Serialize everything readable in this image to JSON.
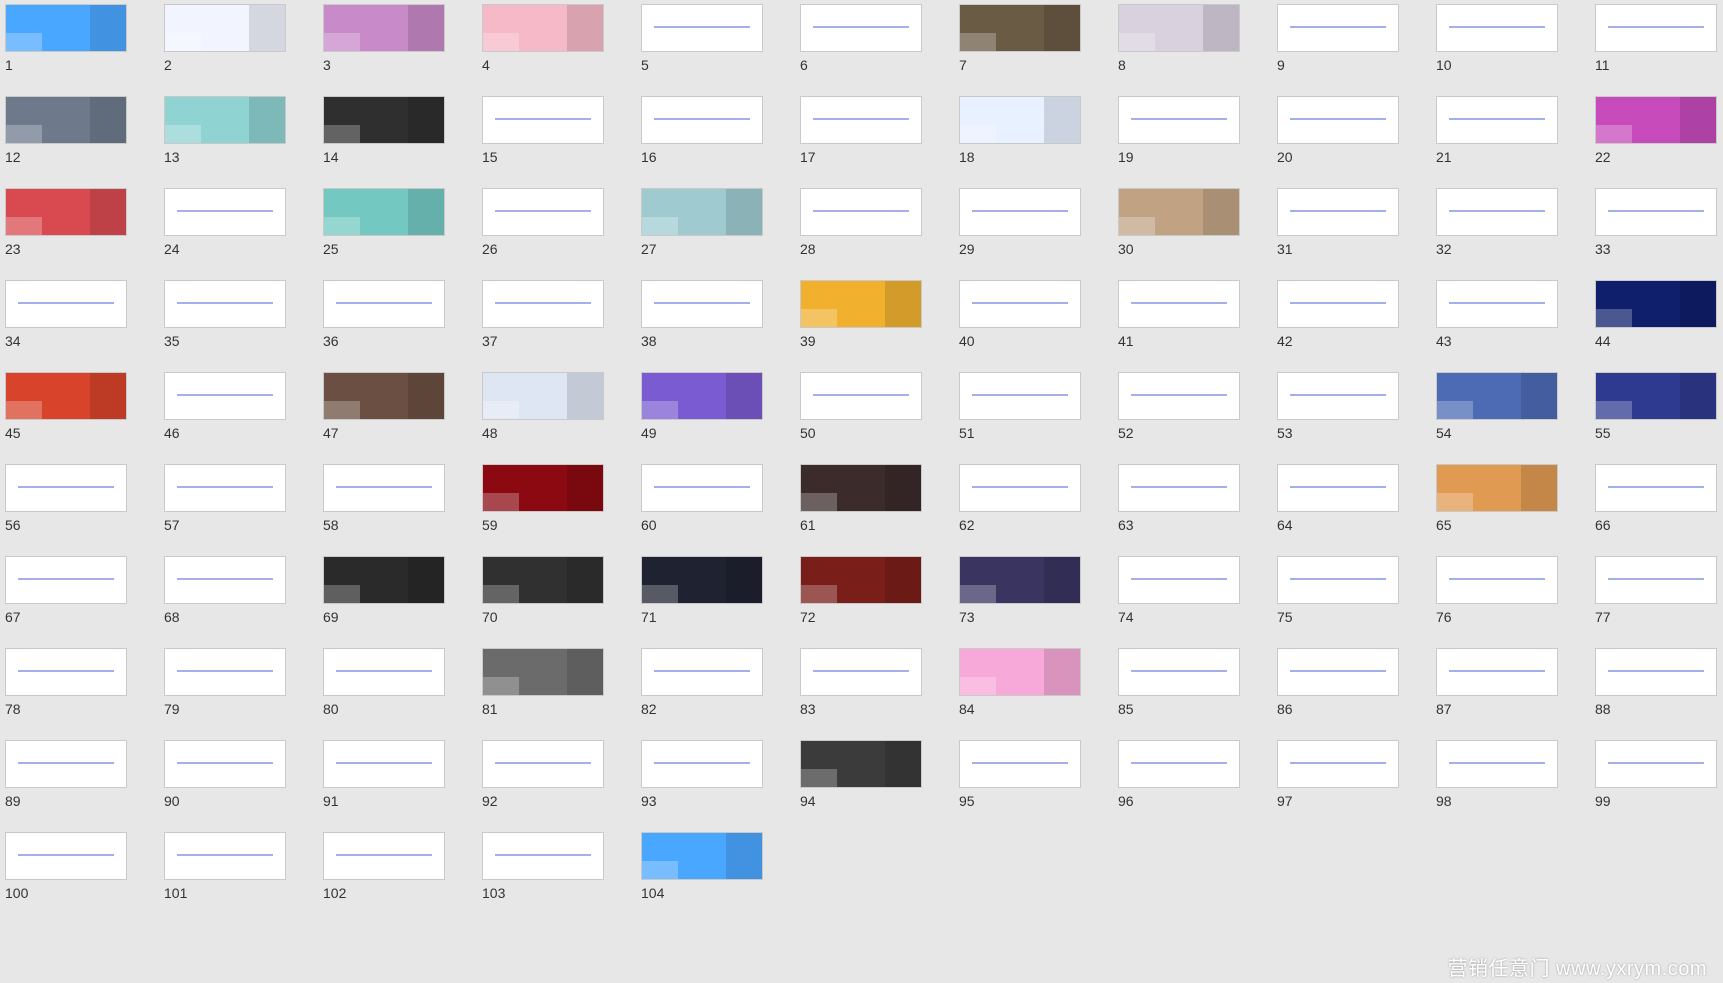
{
  "slides": [
    {
      "num": "1",
      "bg": "#4aa7ff"
    },
    {
      "num": "2",
      "bg": "#f2f5ff"
    },
    {
      "num": "3",
      "bg": "#c88ac9"
    },
    {
      "num": "4",
      "bg": "#f6b9c8"
    },
    {
      "num": "5",
      "bg": "#ffffff"
    },
    {
      "num": "6",
      "bg": "#ffffff"
    },
    {
      "num": "7",
      "bg": "#6a5b45"
    },
    {
      "num": "8",
      "bg": "#d9d1de"
    },
    {
      "num": "9",
      "bg": "#ffffff"
    },
    {
      "num": "10",
      "bg": "#ffffff"
    },
    {
      "num": "11",
      "bg": "#ffffff"
    },
    {
      "num": "12",
      "bg": "#6e7a8c"
    },
    {
      "num": "13",
      "bg": "#8fd3d2"
    },
    {
      "num": "14",
      "bg": "#2f2f2f"
    },
    {
      "num": "15",
      "bg": "#ffffff"
    },
    {
      "num": "16",
      "bg": "#ffffff"
    },
    {
      "num": "17",
      "bg": "#ffffff"
    },
    {
      "num": "18",
      "bg": "#e8f1ff"
    },
    {
      "num": "19",
      "bg": "#ffffff"
    },
    {
      "num": "20",
      "bg": "#ffffff"
    },
    {
      "num": "21",
      "bg": "#ffffff"
    },
    {
      "num": "22",
      "bg": "#c74bbb"
    },
    {
      "num": "23",
      "bg": "#d84a50"
    },
    {
      "num": "24",
      "bg": "#ffffff"
    },
    {
      "num": "25",
      "bg": "#73c9c2"
    },
    {
      "num": "26",
      "bg": "#ffffff"
    },
    {
      "num": "27",
      "bg": "#9fcbd0"
    },
    {
      "num": "28",
      "bg": "#ffffff"
    },
    {
      "num": "29",
      "bg": "#ffffff"
    },
    {
      "num": "30",
      "bg": "#c1a384"
    },
    {
      "num": "31",
      "bg": "#ffffff"
    },
    {
      "num": "32",
      "bg": "#ffffff"
    },
    {
      "num": "33",
      "bg": "#ffffff"
    },
    {
      "num": "34",
      "bg": "#ffffff"
    },
    {
      "num": "35",
      "bg": "#ffffff"
    },
    {
      "num": "36",
      "bg": "#ffffff"
    },
    {
      "num": "37",
      "bg": "#ffffff"
    },
    {
      "num": "38",
      "bg": "#ffffff"
    },
    {
      "num": "39",
      "bg": "#f1b12f"
    },
    {
      "num": "40",
      "bg": "#ffffff"
    },
    {
      "num": "41",
      "bg": "#ffffff"
    },
    {
      "num": "42",
      "bg": "#ffffff"
    },
    {
      "num": "43",
      "bg": "#ffffff"
    },
    {
      "num": "44",
      "bg": "#0f1f6b"
    },
    {
      "num": "45",
      "bg": "#d8432b"
    },
    {
      "num": "46",
      "bg": "#ffffff"
    },
    {
      "num": "47",
      "bg": "#6b4f42"
    },
    {
      "num": "48",
      "bg": "#dfe6f3"
    },
    {
      "num": "49",
      "bg": "#7a5bd1"
    },
    {
      "num": "50",
      "bg": "#ffffff"
    },
    {
      "num": "51",
      "bg": "#ffffff"
    },
    {
      "num": "52",
      "bg": "#ffffff"
    },
    {
      "num": "53",
      "bg": "#ffffff"
    },
    {
      "num": "54",
      "bg": "#4d6ab5"
    },
    {
      "num": "55",
      "bg": "#2e3a8f"
    },
    {
      "num": "56",
      "bg": "#ffffff"
    },
    {
      "num": "57",
      "bg": "#ffffff"
    },
    {
      "num": "58",
      "bg": "#ffffff"
    },
    {
      "num": "59",
      "bg": "#8b0a12"
    },
    {
      "num": "60",
      "bg": "#ffffff"
    },
    {
      "num": "61",
      "bg": "#3b2b2b"
    },
    {
      "num": "62",
      "bg": "#ffffff"
    },
    {
      "num": "63",
      "bg": "#ffffff"
    },
    {
      "num": "64",
      "bg": "#ffffff"
    },
    {
      "num": "65",
      "bg": "#e09a52"
    },
    {
      "num": "66",
      "bg": "#ffffff"
    },
    {
      "num": "67",
      "bg": "#ffffff"
    },
    {
      "num": "68",
      "bg": "#ffffff"
    },
    {
      "num": "69",
      "bg": "#2a2a2a"
    },
    {
      "num": "70",
      "bg": "#303030"
    },
    {
      "num": "71",
      "bg": "#1f2230"
    },
    {
      "num": "72",
      "bg": "#7a1e1a"
    },
    {
      "num": "73",
      "bg": "#3a3460"
    },
    {
      "num": "74",
      "bg": "#ffffff"
    },
    {
      "num": "75",
      "bg": "#ffffff"
    },
    {
      "num": "76",
      "bg": "#ffffff"
    },
    {
      "num": "77",
      "bg": "#ffffff"
    },
    {
      "num": "78",
      "bg": "#ffffff"
    },
    {
      "num": "79",
      "bg": "#ffffff"
    },
    {
      "num": "80",
      "bg": "#ffffff"
    },
    {
      "num": "81",
      "bg": "#6b6b6b"
    },
    {
      "num": "82",
      "bg": "#ffffff"
    },
    {
      "num": "83",
      "bg": "#ffffff"
    },
    {
      "num": "84",
      "bg": "#f7a9d9"
    },
    {
      "num": "85",
      "bg": "#ffffff"
    },
    {
      "num": "86",
      "bg": "#ffffff"
    },
    {
      "num": "87",
      "bg": "#ffffff"
    },
    {
      "num": "88",
      "bg": "#ffffff"
    },
    {
      "num": "89",
      "bg": "#ffffff"
    },
    {
      "num": "90",
      "bg": "#ffffff"
    },
    {
      "num": "91",
      "bg": "#ffffff"
    },
    {
      "num": "92",
      "bg": "#ffffff"
    },
    {
      "num": "93",
      "bg": "#ffffff"
    },
    {
      "num": "94",
      "bg": "#3b3b3b"
    },
    {
      "num": "95",
      "bg": "#ffffff"
    },
    {
      "num": "96",
      "bg": "#ffffff"
    },
    {
      "num": "97",
      "bg": "#ffffff"
    },
    {
      "num": "98",
      "bg": "#ffffff"
    },
    {
      "num": "99",
      "bg": "#ffffff"
    },
    {
      "num": "100",
      "bg": "#ffffff"
    },
    {
      "num": "101",
      "bg": "#ffffff"
    },
    {
      "num": "102",
      "bg": "#ffffff"
    },
    {
      "num": "103",
      "bg": "#ffffff"
    },
    {
      "num": "104",
      "bg": "#4aa7ff"
    }
  ],
  "watermark": "营销任意门 www.yxrym.com"
}
